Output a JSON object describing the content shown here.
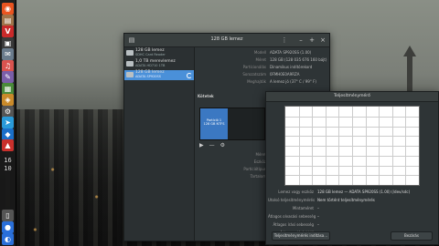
{
  "launcher": {
    "icons": [
      {
        "name": "dash-icon",
        "glyph": "◉",
        "color": "#e95420"
      },
      {
        "name": "files-icon",
        "glyph": "▤",
        "color": "#a0744a"
      },
      {
        "name": "vivaldi-icon",
        "glyph": "V",
        "color": "#c92a2a"
      },
      {
        "name": "terminal-icon",
        "glyph": "▣",
        "color": "#3a3a3a"
      },
      {
        "name": "app-icon-1",
        "glyph": "✉",
        "color": "#6a7b8c"
      },
      {
        "name": "app-icon-2",
        "glyph": "♫",
        "color": "#d9534f"
      },
      {
        "name": "app-icon-3",
        "glyph": "✎",
        "color": "#7a5ea8"
      },
      {
        "name": "app-icon-4",
        "glyph": "▦",
        "color": "#4a8a3a"
      },
      {
        "name": "app-icon-5",
        "glyph": "◈",
        "color": "#c98a2a"
      },
      {
        "name": "app-icon-6",
        "glyph": "⚙",
        "color": "#555"
      },
      {
        "name": "telegram-icon",
        "glyph": "➤",
        "color": "#2a9ad9"
      },
      {
        "name": "app-icon-7",
        "glyph": "◆",
        "color": "#1a6fc9"
      },
      {
        "name": "app-icon-8",
        "glyph": "▲",
        "color": "#c9302c"
      }
    ],
    "clock_hour": "16",
    "clock_min": "10",
    "bottom_icons": [
      {
        "name": "trash-icon",
        "glyph": "▯",
        "color": "#555"
      },
      {
        "name": "app-icon-9",
        "glyph": "●",
        "color": "#2a6fd9"
      },
      {
        "name": "app-icon-10",
        "glyph": "◐",
        "color": "#2a6fd9"
      }
    ]
  },
  "window": {
    "title": "128 GB lemez",
    "drives": [
      {
        "name": "128 GB lemez",
        "sub": "SDHC Card Reader"
      },
      {
        "name": "1,0 TB merevlemez",
        "sub": "ADATA HD710 1TB"
      },
      {
        "name": "128 GB lemez",
        "sub": "ADATA SP920SS"
      }
    ],
    "details": [
      {
        "label": "Modell",
        "value": "ADATA SP920SS (1.00)"
      },
      {
        "label": "Méret",
        "value": "128 GB (128 035 676 160 bájt)"
      },
      {
        "label": "Partícionálás",
        "value": "Dinamikus indítórekord"
      },
      {
        "label": "Sorozatszám",
        "value": "0FMH0E0A9RZA"
      },
      {
        "label": "Meghajtók",
        "value": "A lemez jó (37° C / 99° F)"
      }
    ],
    "volumes_heading": "Kötetek",
    "volume_seg_name": "Partíció 1",
    "volume_seg_size": "128 GB NTFS",
    "volume_details": [
      {
        "label": "Méret",
        "value": "77 GB (76 777 216 000 bájt)"
      },
      {
        "label": "Eszköz",
        "value": "/dev/sdc1"
      },
      {
        "label": "Partíciótípus",
        "value": "Linux"
      },
      {
        "label": "Tartalom",
        "value": "Ext4 (7.4 verzió) — Nincs csatolva"
      }
    ],
    "tools": [
      "▶",
      "—",
      "⚙"
    ]
  },
  "dialog": {
    "title": "Teljesítménymérő",
    "y_left": [
      "",
      "",
      "",
      "",
      "",
      "",
      "",
      ""
    ],
    "y_right": [
      "",
      "",
      "",
      "",
      "",
      "",
      "",
      ""
    ],
    "info": [
      {
        "label": "Lemez vagy eszköz",
        "value": "128 GB lemez — ADATA SP920SS (1.00) (/dev/sdc)"
      },
      {
        "label": "Utolsó teljesítménymérés",
        "value": "Nem történt teljesítménymérés"
      },
      {
        "label": "Mintaméret",
        "value": "–"
      },
      {
        "label": "Átlagos olvasási sebesség",
        "value": "–"
      },
      {
        "label": "Átlagos írási sebesség",
        "value": "–"
      },
      {
        "label": "Átlagos elérési idő",
        "value": "–"
      }
    ],
    "start_button": "Teljesítménymérés indítása…",
    "close_button": "Bezárás"
  }
}
